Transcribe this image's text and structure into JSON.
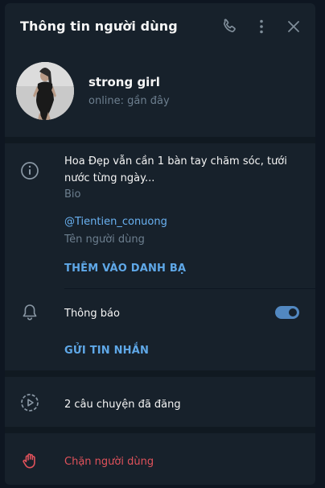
{
  "header": {
    "title": "Thông tin người dùng",
    "icons": [
      "phone-icon",
      "more-vertical-icon",
      "close-icon"
    ]
  },
  "profile": {
    "name": "strong girl",
    "status": "online: gần đây"
  },
  "info": {
    "bio_text": "Hoa Đẹp vẫn cần 1 bàn tay chăm sóc, tưới nước từng ngày...",
    "bio_label": "Bio",
    "username": "@Tientien_conuong",
    "username_label": "Tên người dùng",
    "add_contact": "THÊM VÀO DANH BẠ"
  },
  "notifications": {
    "label": "Thông báo",
    "enabled": true,
    "send_message": "GỬI TIN NHẮN"
  },
  "stories": {
    "label": "2 câu chuyện đã đăng"
  },
  "block": {
    "label": "Chặn người dùng"
  },
  "colors": {
    "background": "#17212b",
    "accent": "#5288c1",
    "link": "#6ab2f2",
    "danger": "#e0525b"
  }
}
